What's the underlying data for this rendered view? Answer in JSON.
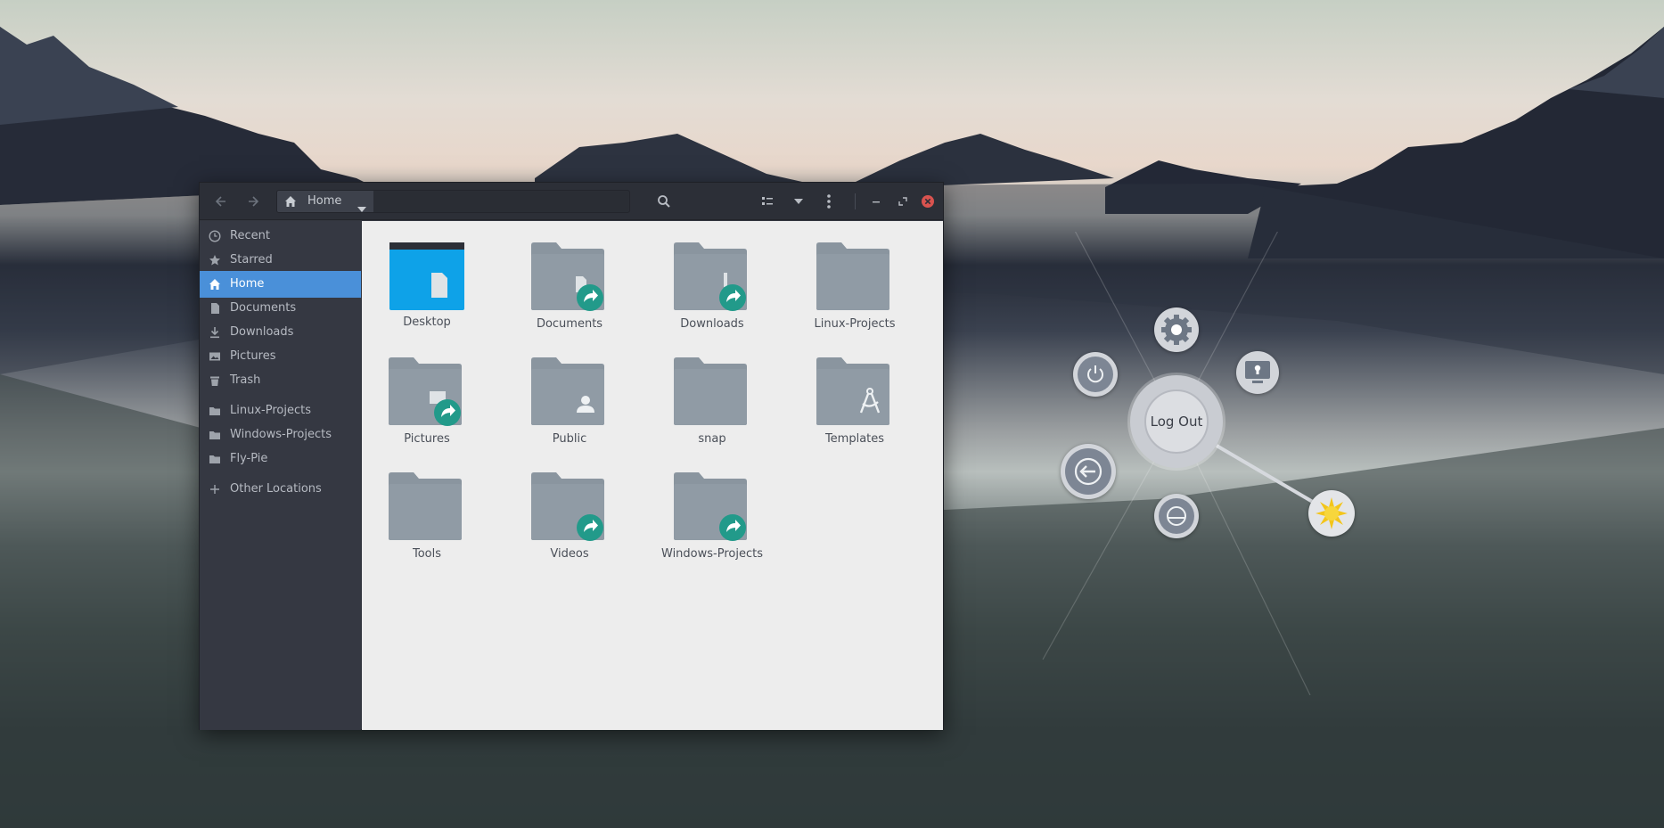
{
  "window": {
    "path_label": "Home"
  },
  "sidebar": {
    "items": [
      {
        "label": "Recent",
        "icon": "clock-icon"
      },
      {
        "label": "Starred",
        "icon": "star-icon"
      },
      {
        "label": "Home",
        "icon": "home-icon",
        "active": true
      },
      {
        "label": "Documents",
        "icon": "document-icon"
      },
      {
        "label": "Downloads",
        "icon": "download-icon"
      },
      {
        "label": "Pictures",
        "icon": "image-icon"
      },
      {
        "label": "Trash",
        "icon": "trash-icon"
      },
      {
        "label": "Linux-Projects",
        "icon": "folder-icon"
      },
      {
        "label": "Windows-Projects",
        "icon": "folder-icon"
      },
      {
        "label": "Fly-Pie",
        "icon": "folder-icon"
      },
      {
        "label": "Other Locations",
        "icon": "plus-icon"
      }
    ]
  },
  "files": [
    {
      "name": "Desktop",
      "kind": "desktop"
    },
    {
      "name": "Documents",
      "kind": "link"
    },
    {
      "name": "Downloads",
      "kind": "link"
    },
    {
      "name": "Linux-Projects",
      "kind": "folder"
    },
    {
      "name": "Pictures",
      "kind": "link"
    },
    {
      "name": "Public",
      "kind": "public"
    },
    {
      "name": "snap",
      "kind": "folder"
    },
    {
      "name": "Templates",
      "kind": "templates"
    },
    {
      "name": "Tools",
      "kind": "folder"
    },
    {
      "name": "Videos",
      "kind": "link"
    },
    {
      "name": "Windows-Projects",
      "kind": "link"
    }
  ],
  "flypie": {
    "center_label": "Log Out",
    "children": [
      "gear-icon",
      "lock-screen-icon",
      "sun-icon",
      "suspend-icon",
      "logout-arrow-icon",
      "power-icon"
    ]
  },
  "colors": {
    "accent": "#4a90d9",
    "folder": "#8a959f",
    "link_badge": "#229a8a",
    "desktop_folder": "#0ea2e8",
    "close": "#d9534f"
  }
}
